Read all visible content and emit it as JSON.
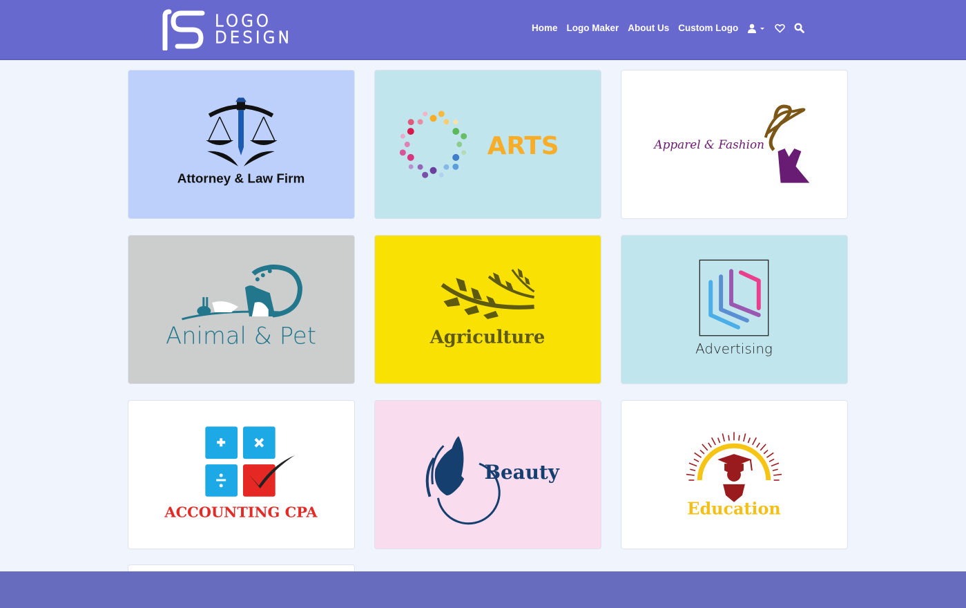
{
  "header": {
    "brand": {
      "line1": "LOGO",
      "line2": "DESIGN",
      "icon": "rs-monogram-logo"
    },
    "nav": [
      {
        "label": "Home"
      },
      {
        "label": "Logo Maker"
      },
      {
        "label": "About Us"
      },
      {
        "label": "Custom Logo"
      }
    ],
    "icons": {
      "user": "user-icon",
      "dropdown": "caret-down-icon",
      "wishlist": "heart-icon",
      "search": "search-icon"
    }
  },
  "colors": {
    "navbar": "#6869cf",
    "page_bg": "#f0f5fd",
    "footer": "#686cbe"
  },
  "logos": [
    {
      "category": "Attorney & Law Firm",
      "text": "Attorney & Law Firm",
      "bg": "#bdd0fb",
      "icon": "scales-of-justice-icon"
    },
    {
      "category": "Arts",
      "text": "ARTS",
      "bg": "#c1e5ed",
      "icon": "color-dots-ring-icon"
    },
    {
      "category": "Apparel & Fashion",
      "text": "Apparel & Fashion",
      "bg": "#ffffff",
      "icon": "woman-with-hat-icon"
    },
    {
      "category": "Animal & Pet",
      "text": "Animal & Pet",
      "bg": "#cccdcd",
      "icon": "pets-silhouette-icon"
    },
    {
      "category": "Agriculture",
      "text": "Agriculture",
      "bg": "#f9e103",
      "icon": "wheat-icon"
    },
    {
      "category": "Advertising",
      "text": "Advertising",
      "bg": "#c1e5ed",
      "icon": "layered-frames-icon"
    },
    {
      "category": "Accounting CPA",
      "text": "ACCOUNTING CPA",
      "bg": "#ffffff",
      "icon": "calculator-check-icon"
    },
    {
      "category": "Beauty",
      "text": "Beauty",
      "bg": "#fadcef",
      "icon": "woman-profile-icon"
    },
    {
      "category": "Education",
      "text": "Education",
      "bg": "#ffffff",
      "icon": "graduation-cap-icon"
    }
  ]
}
